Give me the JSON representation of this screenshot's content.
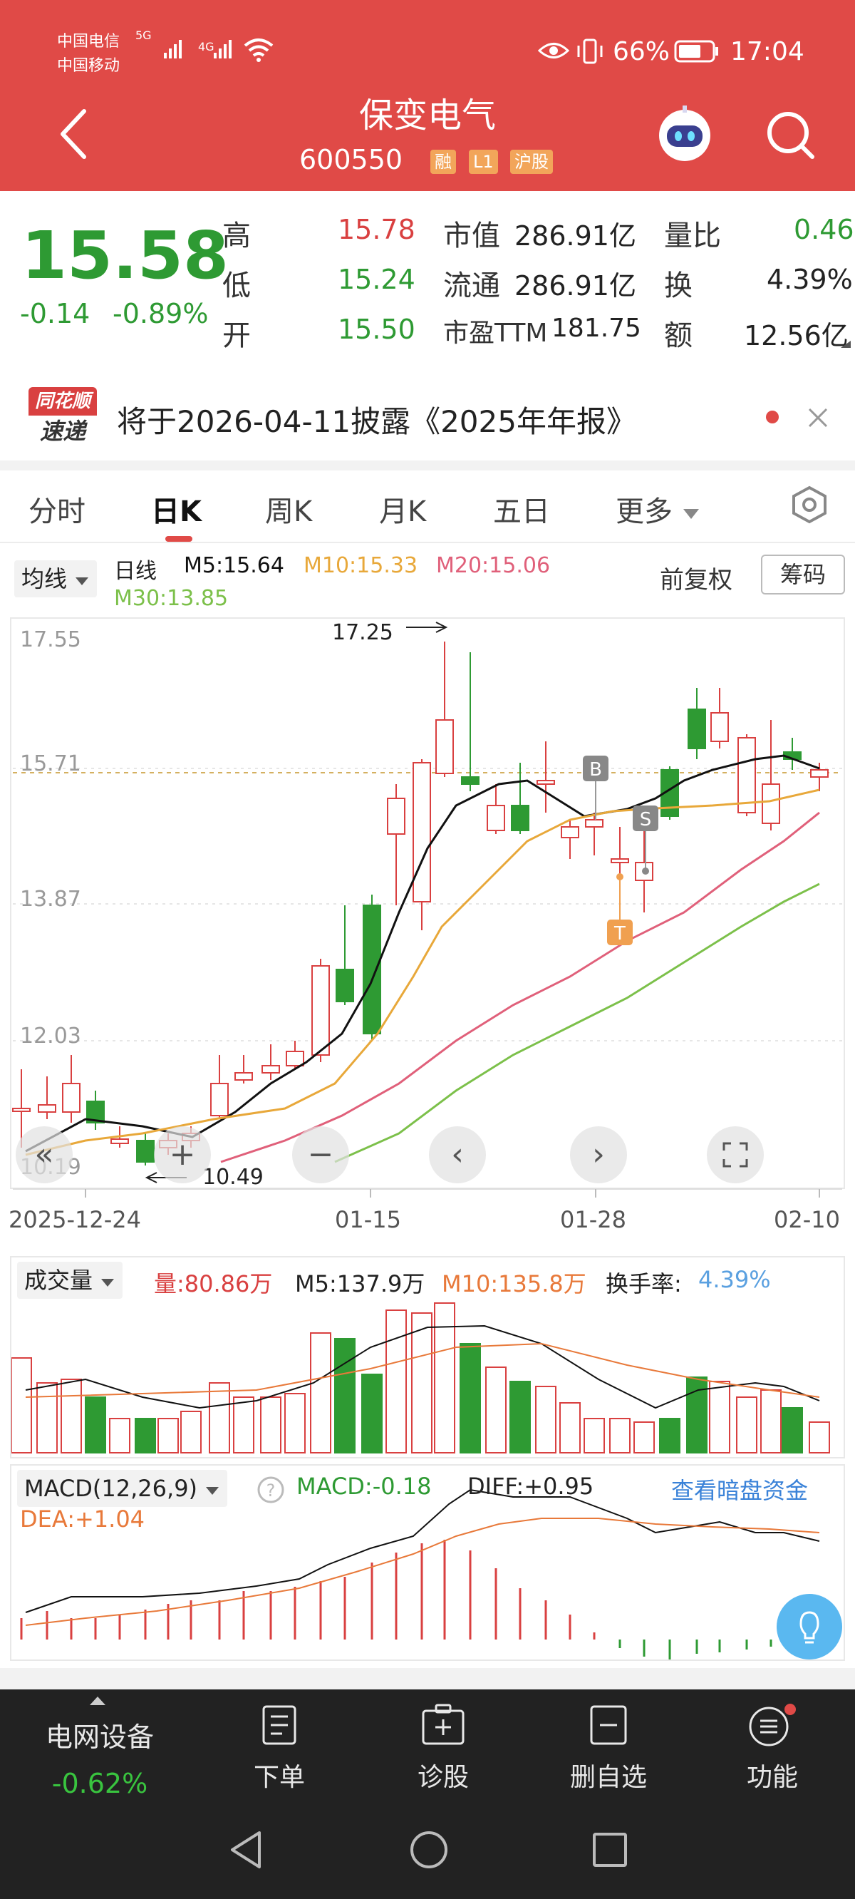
{
  "status_bar": {
    "carrier1": "中国电信",
    "carrier2": "中国移动",
    "net1": "5G",
    "net2": "4G",
    "battery": "66%",
    "time": "17:04"
  },
  "header": {
    "title": "保变电气",
    "code": "600550",
    "tags": [
      "融",
      "L1",
      "沪股"
    ],
    "icons": [
      "back-icon",
      "robot-assistant-icon",
      "search-icon"
    ]
  },
  "quote": {
    "price": "15.58",
    "change": "-0.14",
    "change_pct": "-0.89%",
    "stats": [
      {
        "label": "高",
        "value": "15.78",
        "color": "red"
      },
      {
        "label": "低",
        "value": "15.24",
        "color": "green"
      },
      {
        "label": "开",
        "value": "15.50",
        "color": "green"
      }
    ],
    "stats2": [
      {
        "label": "市值",
        "value": "286.91亿"
      },
      {
        "label": "流通",
        "value": "286.91亿"
      },
      {
        "label": "市盈TTM",
        "value": "181.75"
      }
    ],
    "stats3": [
      {
        "label": "量比",
        "value": "0.46",
        "color": "green"
      },
      {
        "label": "换",
        "value": "4.39%",
        "color": "dark"
      },
      {
        "label": "额",
        "value": "12.56亿",
        "color": "dark"
      }
    ]
  },
  "notice": {
    "logo_line1": "同花顺",
    "logo_line2": "速递",
    "text": "将于2026-04-11披露《2025年年报》"
  },
  "tabs": [
    "分时",
    "日K",
    "周K",
    "月K",
    "五日",
    "更多"
  ],
  "active_tab": "日K",
  "ma_bar": {
    "selector": "均线",
    "period": "日线",
    "m5": "M5:15.64",
    "m10": "M10:15.33",
    "m20": "M20:15.06",
    "m30": "M30:13.85",
    "adjust": "前复权",
    "chips": "筹码"
  },
  "kline": {
    "y_labels": [
      "17.55",
      "15.71",
      "13.87",
      "12.03",
      "10.19"
    ],
    "dates": [
      "2025-12-24",
      "01-15",
      "01-28",
      "02-10"
    ],
    "high_annotation": "17.25",
    "low_annotation": "10.49",
    "markers": [
      "B",
      "S",
      "T"
    ]
  },
  "volume": {
    "selector": "成交量",
    "vol": "量:80.86万",
    "m5": "M5:137.9万",
    "m10": "M10:135.8万",
    "turnover_label": "换手率:",
    "turnover": "4.39%"
  },
  "macd": {
    "selector": "MACD(12,26,9)",
    "macd": "MACD:-0.18",
    "diff": "DIFF:+0.95",
    "dea": "DEA:+1.04",
    "link": "查看暗盘资金"
  },
  "bottom_nav": {
    "sector_name": "电网设备",
    "sector_change": "-0.62%",
    "items": [
      "下单",
      "诊股",
      "删自选",
      "功能"
    ]
  },
  "colors": {
    "header_bg": "#e04a47",
    "up": "#d94040",
    "down": "#2e9a33",
    "ma5": "#111111",
    "ma10": "#e8a83a",
    "ma20": "#e0607a",
    "ma30": "#7cc04a"
  }
}
